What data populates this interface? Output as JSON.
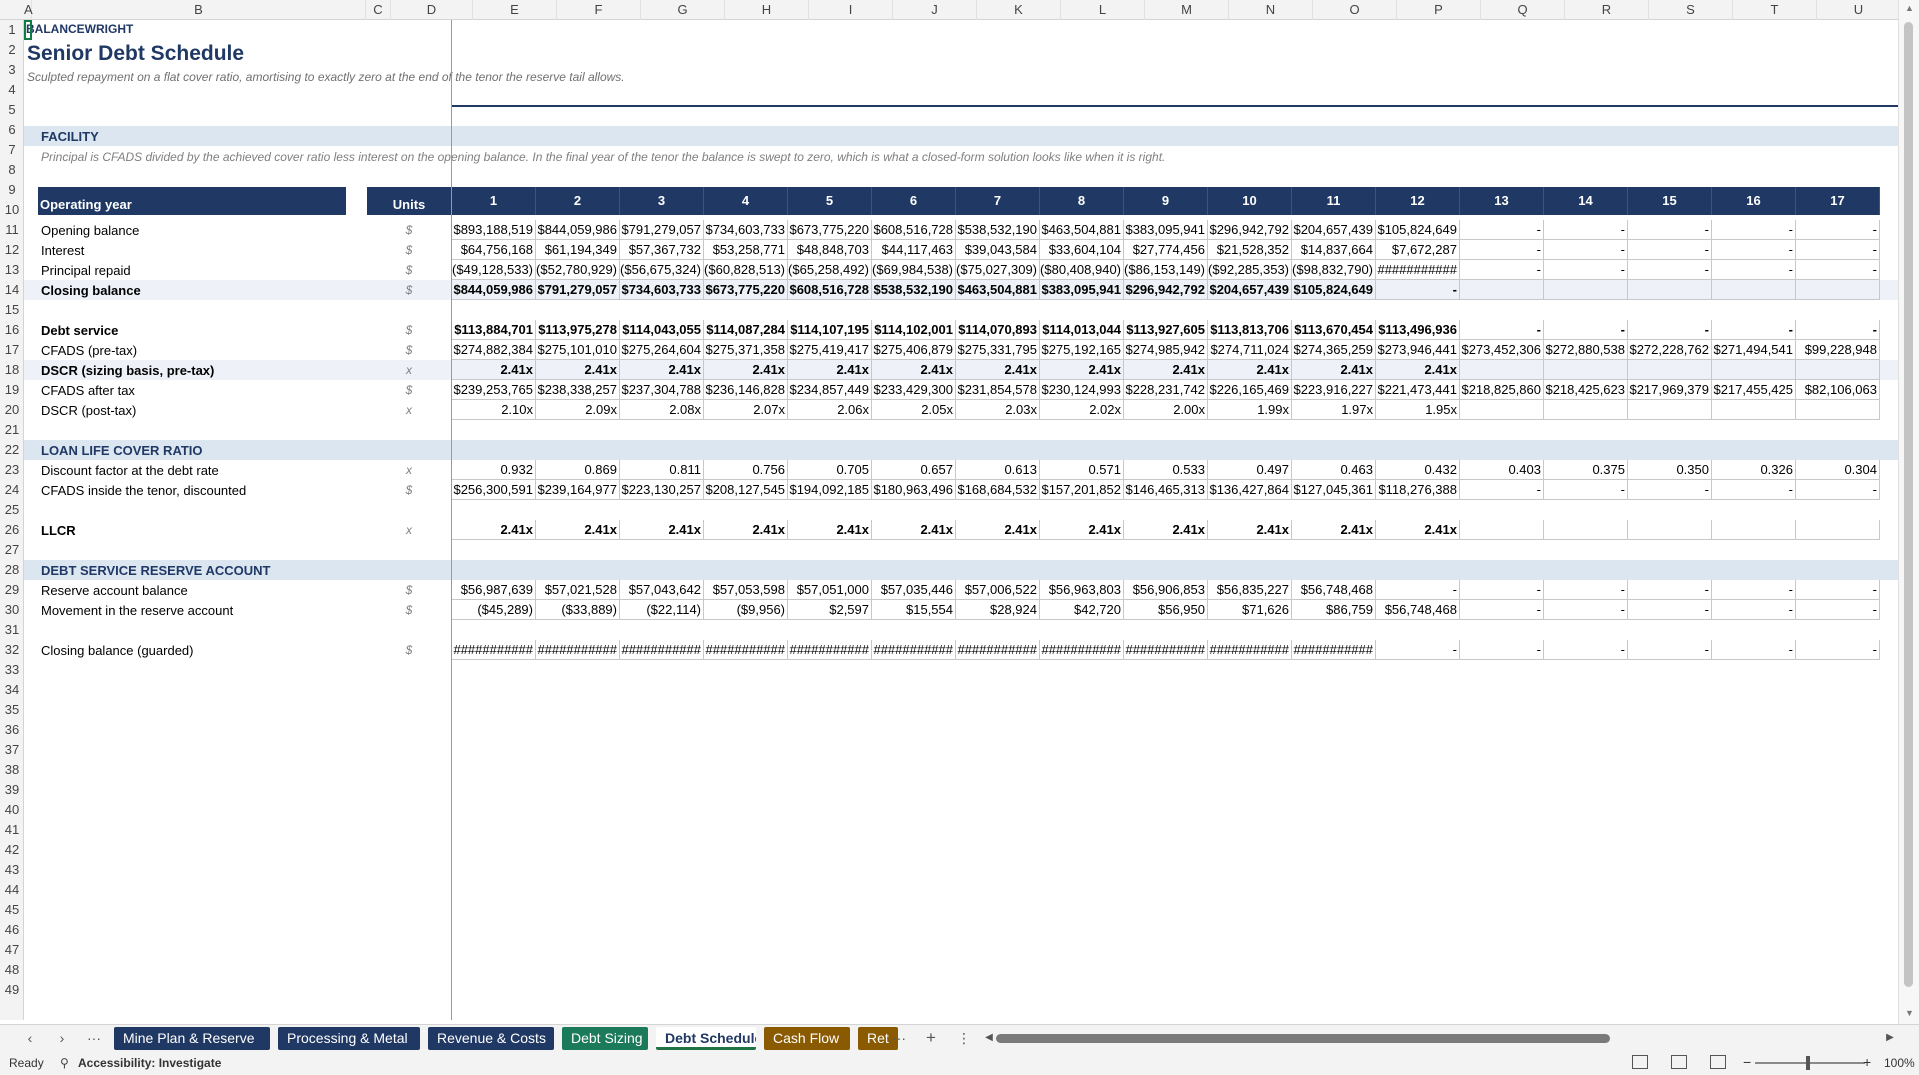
{
  "columns": [
    "A",
    "B",
    "C",
    "D",
    "E",
    "F",
    "G",
    "H",
    "I",
    "J",
    "K",
    "L",
    "M",
    "N",
    "O",
    "P",
    "Q",
    "R",
    "S",
    "T",
    "U"
  ],
  "rows": [
    "1",
    "2",
    "3",
    "4",
    "5",
    "6",
    "7",
    "8",
    "9",
    "10",
    "11",
    "12",
    "13",
    "14",
    "15",
    "16",
    "17",
    "18",
    "19",
    "20",
    "21",
    "22",
    "23",
    "24",
    "25",
    "26",
    "27",
    "28",
    "29",
    "30",
    "31",
    "32",
    "33",
    "34",
    "35",
    "36",
    "37",
    "38",
    "39",
    "40",
    "41",
    "42",
    "43",
    "44",
    "45",
    "46",
    "47",
    "48",
    "49"
  ],
  "brand": "BALANCEWRIGHT",
  "title": "Senior Debt Schedule",
  "subtitle": "Sculpted repayment on a flat cover ratio, amortising to exactly zero at the end of the tenor the reserve tail allows.",
  "facility": {
    "section": "FACILITY",
    "note": "Principal is CFADS divided by the achieved cover ratio less interest on the opening balance. In the final year of the tenor the balance is swept to zero, which is what a closed-form solution looks like when it is right."
  },
  "header": {
    "label": "Operating year",
    "units": "Units",
    "years": [
      "1",
      "2",
      "3",
      "4",
      "5",
      "6",
      "7",
      "8",
      "9",
      "10",
      "11",
      "12",
      "13",
      "14",
      "15",
      "16",
      "17"
    ]
  },
  "debt_rows": [
    {
      "label": "Opening balance",
      "unit": "$",
      "bold": false,
      "values": [
        "$893,188,519",
        "$844,059,986",
        "$791,279,057",
        "$734,603,733",
        "$673,775,220",
        "$608,516,728",
        "$538,532,190",
        "$463,504,881",
        "$383,095,941",
        "$296,942,792",
        "$204,657,439",
        "$105,824,649",
        "-",
        "-",
        "-",
        "-",
        "-"
      ]
    },
    {
      "label": "Interest",
      "unit": "$",
      "bold": false,
      "values": [
        "$64,756,168",
        "$61,194,349",
        "$57,367,732",
        "$53,258,771",
        "$48,848,703",
        "$44,117,463",
        "$39,043,584",
        "$33,604,104",
        "$27,774,456",
        "$21,528,352",
        "$14,837,664",
        "$7,672,287",
        "-",
        "-",
        "-",
        "-",
        "-"
      ]
    },
    {
      "label": "Principal repaid",
      "unit": "$",
      "bold": false,
      "values": [
        "($49,128,533)",
        "($52,780,929)",
        "($56,675,324)",
        "($60,828,513)",
        "($65,258,492)",
        "($69,984,538)",
        "($75,027,309)",
        "($80,408,940)",
        "($86,153,149)",
        "($92,285,353)",
        "($98,832,790)",
        "###########",
        "-",
        "-",
        "-",
        "-",
        "-"
      ]
    },
    {
      "label": "Closing balance",
      "unit": "$",
      "bold": true,
      "values": [
        "$844,059,986",
        "$791,279,057",
        "$734,603,733",
        "$673,775,220",
        "$608,516,728",
        "$538,532,190",
        "$463,504,881",
        "$383,095,941",
        "$296,942,792",
        "$204,657,439",
        "$105,824,649",
        "-",
        "",
        "",
        "",
        "",
        ""
      ]
    }
  ],
  "service_rows": [
    {
      "label": "Debt service",
      "unit": "$",
      "bold": true,
      "values": [
        "$113,884,701",
        "$113,975,278",
        "$114,043,055",
        "$114,087,284",
        "$114,107,195",
        "$114,102,001",
        "$114,070,893",
        "$114,013,044",
        "$113,927,605",
        "$113,813,706",
        "$113,670,454",
        "$113,496,936",
        "-",
        "-",
        "-",
        "-",
        "-"
      ]
    },
    {
      "label": "CFADS (pre-tax)",
      "unit": "$",
      "bold": false,
      "values": [
        "$274,882,384",
        "$275,101,010",
        "$275,264,604",
        "$275,371,358",
        "$275,419,417",
        "$275,406,879",
        "$275,331,795",
        "$275,192,165",
        "$274,985,942",
        "$274,711,024",
        "$274,365,259",
        "$273,946,441",
        "$273,452,306",
        "$272,880,538",
        "$272,228,762",
        "$271,494,541",
        "$99,228,948"
      ]
    },
    {
      "label": "DSCR (sizing basis, pre-tax)",
      "unit": "x",
      "bold": true,
      "values": [
        "2.41x",
        "2.41x",
        "2.41x",
        "2.41x",
        "2.41x",
        "2.41x",
        "2.41x",
        "2.41x",
        "2.41x",
        "2.41x",
        "2.41x",
        "2.41x",
        "",
        "",
        "",
        "",
        ""
      ]
    },
    {
      "label": "CFADS after tax",
      "unit": "$",
      "bold": false,
      "values": [
        "$239,253,765",
        "$238,338,257",
        "$237,304,788",
        "$236,146,828",
        "$234,857,449",
        "$233,429,300",
        "$231,854,578",
        "$230,124,993",
        "$228,231,742",
        "$226,165,469",
        "$223,916,227",
        "$221,473,441",
        "$218,825,860",
        "$218,425,623",
        "$217,969,379",
        "$217,455,425",
        "$82,106,063"
      ]
    },
    {
      "label": "DSCR (post-tax)",
      "unit": "x",
      "bold": false,
      "values": [
        "2.10x",
        "2.09x",
        "2.08x",
        "2.07x",
        "2.06x",
        "2.05x",
        "2.03x",
        "2.02x",
        "2.00x",
        "1.99x",
        "1.97x",
        "1.95x",
        "",
        "",
        "",
        "",
        ""
      ]
    }
  ],
  "llcr": {
    "section": "LOAN LIFE COVER RATIO",
    "rows": [
      {
        "label": "Discount factor at the debt rate",
        "unit": "x",
        "bold": false,
        "values": [
          "0.932",
          "0.869",
          "0.811",
          "0.756",
          "0.705",
          "0.657",
          "0.613",
          "0.571",
          "0.533",
          "0.497",
          "0.463",
          "0.432",
          "0.403",
          "0.375",
          "0.350",
          "0.326",
          "0.304"
        ]
      },
      {
        "label": "CFADS inside the tenor, discounted",
        "unit": "$",
        "bold": false,
        "values": [
          "$256,300,591",
          "$239,164,977",
          "$223,130,257",
          "$208,127,545",
          "$194,092,185",
          "$180,963,496",
          "$168,684,532",
          "$157,201,852",
          "$146,465,313",
          "$136,427,864",
          "$127,045,361",
          "$118,276,388",
          "-",
          "-",
          "-",
          "-",
          "-"
        ]
      }
    ],
    "total": {
      "label": "LLCR",
      "unit": "x",
      "bold": true,
      "values": [
        "2.41x",
        "2.41x",
        "2.41x",
        "2.41x",
        "2.41x",
        "2.41x",
        "2.41x",
        "2.41x",
        "2.41x",
        "2.41x",
        "2.41x",
        "2.41x",
        "",
        "",
        "",
        "",
        ""
      ]
    }
  },
  "dsra": {
    "section": "DEBT SERVICE RESERVE ACCOUNT",
    "rows": [
      {
        "label": "Reserve account balance",
        "unit": "$",
        "bold": false,
        "values": [
          "$56,987,639",
          "$57,021,528",
          "$57,043,642",
          "$57,053,598",
          "$57,051,000",
          "$57,035,446",
          "$57,006,522",
          "$56,963,803",
          "$56,906,853",
          "$56,835,227",
          "$56,748,468",
          "-",
          "-",
          "-",
          "-",
          "-",
          "-"
        ]
      },
      {
        "label": "Movement in the reserve account",
        "unit": "$",
        "bold": false,
        "values": [
          "($45,289)",
          "($33,889)",
          "($22,114)",
          "($9,956)",
          "$2,597",
          "$15,554",
          "$28,924",
          "$42,720",
          "$56,950",
          "$71,626",
          "$86,759",
          "$56,748,468",
          "-",
          "-",
          "-",
          "-",
          "-"
        ]
      }
    ],
    "guarded": {
      "label": "Closing balance (guarded)",
      "unit": "$",
      "bold": false,
      "values": [
        "###########",
        "###########",
        "###########",
        "###########",
        "###########",
        "###########",
        "###########",
        "###########",
        "###########",
        "###########",
        "###########",
        "-",
        "-",
        "-",
        "-",
        "-",
        "-"
      ]
    }
  },
  "tabs": [
    {
      "label": "Mine Plan & Reserve",
      "color": "#1f3864",
      "active": false
    },
    {
      "label": "Processing & Metal",
      "color": "#1f3864",
      "active": false
    },
    {
      "label": "Revenue & Costs",
      "color": "#1f3864",
      "active": false
    },
    {
      "label": "Debt Sizing",
      "color": "#1b7a5a",
      "active": false
    },
    {
      "label": "Debt Schedule",
      "color": "#1b7a5a",
      "active": true
    },
    {
      "label": "Cash Flow",
      "color": "#8a5a00",
      "active": false
    },
    {
      "label": "Ret",
      "color": "#8a5a00",
      "active": false
    }
  ],
  "tabbar": {
    "more": "···",
    "add": "+",
    "options": "⋮"
  },
  "status": {
    "ready": "Ready",
    "accessibility": "Accessibility: Investigate",
    "zoom": "100%"
  }
}
